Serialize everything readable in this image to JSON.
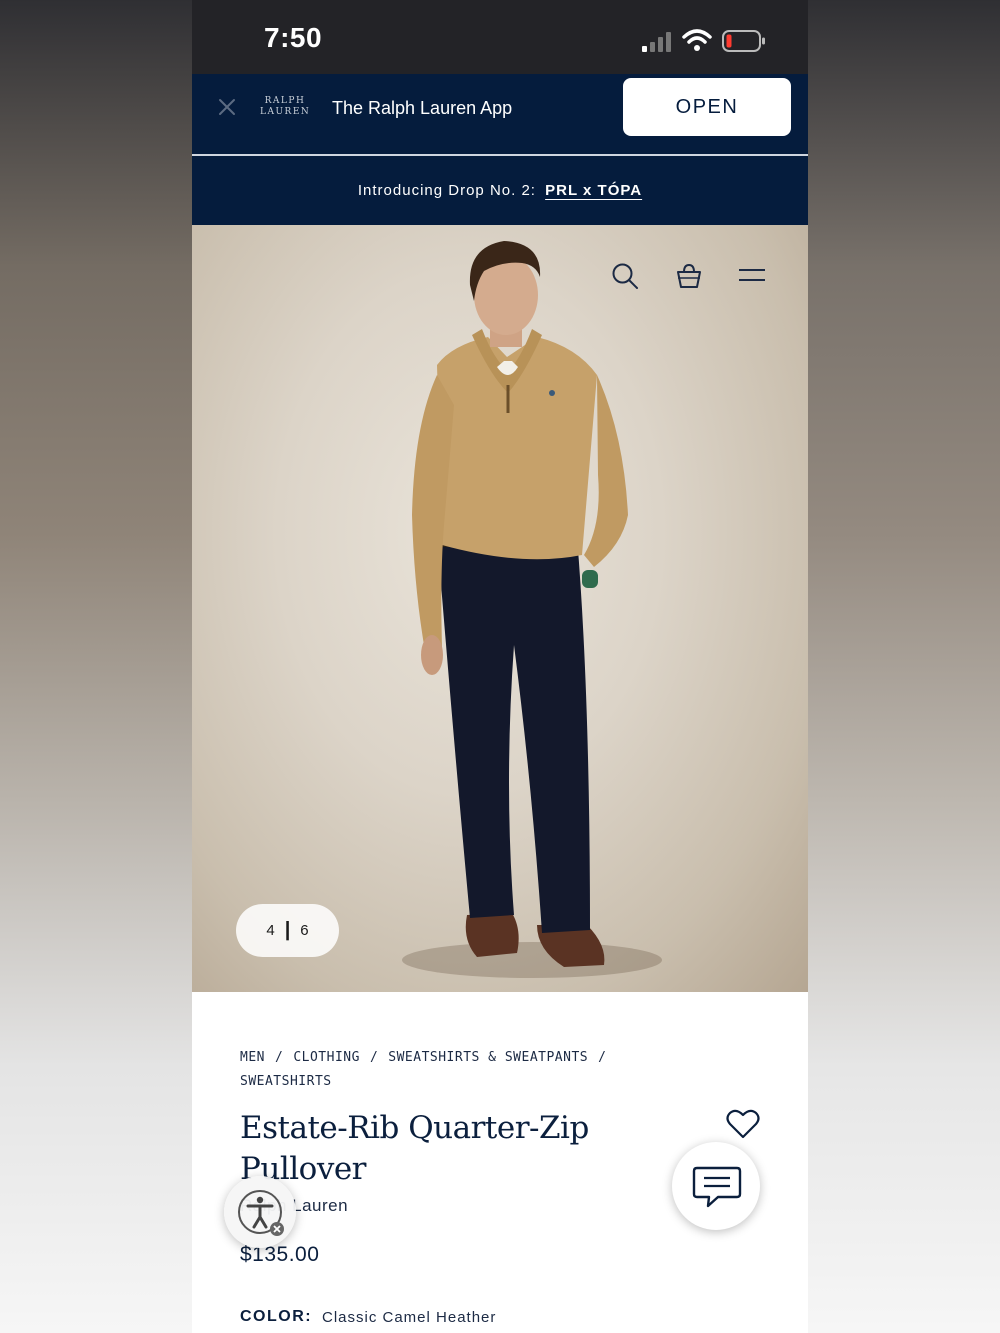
{
  "status_bar": {
    "time": "7:50"
  },
  "app_banner": {
    "logo_line1": "RALPH",
    "logo_line2": "LAUREN",
    "text": "The Ralph Lauren App",
    "open_label": "OPEN"
  },
  "promo": {
    "text": "Introducing Drop No. 2:",
    "link": "PRL x TÓPA"
  },
  "gallery": {
    "current": "4",
    "separator": "|",
    "total": "6"
  },
  "breadcrumb": [
    "MEN",
    "CLOTHING",
    "SWEATSHIRTS & SWEATPANTS",
    "SWEATSHIRTS"
  ],
  "breadcrumb_sep": "/",
  "product": {
    "title": "Estate-Rib Quarter-Zip Pullover",
    "brand": "Ralph Lauren",
    "price": "$135.00",
    "color_label": "COLOR:",
    "color_value": "Classic Camel Heather"
  },
  "icons": {
    "close": "close-icon",
    "search": "search-icon",
    "bag": "shopping-bag-icon",
    "menu": "hamburger-menu-icon",
    "wishlist": "heart-icon",
    "chat": "chat-icon",
    "accessibility": "accessibility-icon"
  },
  "colors": {
    "navy": "#051c3d",
    "status_bar": "#232327",
    "text_dark": "#0b1f3d"
  }
}
